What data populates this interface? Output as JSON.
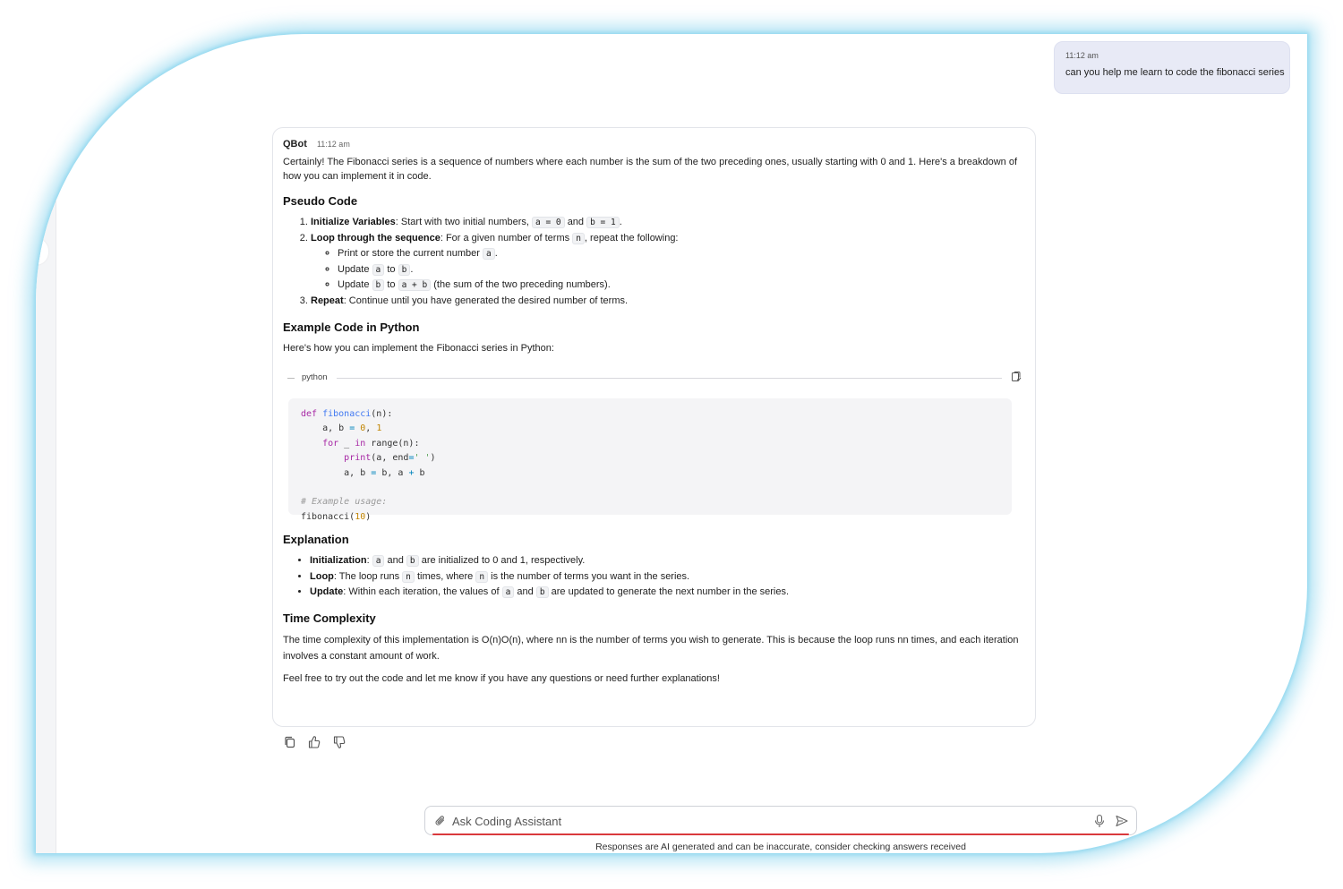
{
  "user_message": {
    "time": "11:12 am",
    "text": "can you help me learn to code the fibonacci series"
  },
  "bot_message": {
    "name": "QBot",
    "time": "11:12 am",
    "intro": "Certainly! The Fibonacci series is a sequence of numbers where each number is the sum of the two preceding ones, usually starting with 0 and 1. Here's a breakdown of how you can implement it in code.",
    "pseudo": {
      "heading": "Pseudo Code",
      "step1_title": "Initialize Variables",
      "step1_text": ": Start with two initial numbers,",
      "step1_code_a": "a = 0",
      "step1_and": "and",
      "step1_code_b": "b = 1",
      "step2_title": "Loop through the sequence",
      "step2_text": ": For a given number of terms",
      "step2_code_n": "n",
      "step2_text2": ", repeat the following:",
      "sub1_text": "Print or store the current number",
      "sub1_code": "a",
      "sub2_text": "Update",
      "sub2_code1": "a",
      "sub2_to": "to",
      "sub2_code2": "b",
      "sub3_text": "Update",
      "sub3_code1": "b",
      "sub3_to": "to",
      "sub3_code2": "a + b",
      "sub3_text2": "(the sum of the two preceding numbers).",
      "step3_title": "Repeat",
      "step3_text": ": Continue until you have generated the desired number of terms."
    },
    "example": {
      "heading": "Example Code in Python",
      "text": "Here's how you can implement the Fibonacci series in Python:",
      "language": "python"
    },
    "explanation": {
      "heading": "Explanation",
      "b1_title": "Initialization",
      "b1_code1": "a",
      "b1_and": "and",
      "b1_code2": "b",
      "b1_text": "are initialized to 0 and 1, respectively.",
      "b2_title": "Loop",
      "b2_text": ": The loop runs",
      "b2_code": "n",
      "b2_text2": "times, where",
      "b2_code2": "n",
      "b2_text3": "is the number of terms you want in the series.",
      "b3_title": "Update",
      "b3_text": ": Within each iteration, the values of",
      "b3_code1": "a",
      "b3_and": "and",
      "b3_code2": "b",
      "b3_text2": "are updated to generate the next number in the series."
    },
    "complexity": {
      "heading": "Time Complexity",
      "text": "The time complexity of this implementation is O(n)O(n), where nn is the number of terms you wish to generate. This is because the loop runs nn times, and each iteration involves a constant amount of work."
    },
    "outro": "Feel free to try out the code and let me know if you have any questions or need further explanations!"
  },
  "icons": {
    "copy_code": "copy-code-icon",
    "copy": "copy-icon",
    "thumbs_up": "thumbs-up-icon",
    "thumbs_down": "thumbs-down-icon",
    "attach": "paperclip-icon",
    "mic": "microphone-icon",
    "send": "send-icon"
  },
  "input": {
    "placeholder": "Ask Coding Assistant",
    "value": ""
  },
  "disclaimer": "Responses are AI generated and can be inaccurate, consider checking answers received",
  "colors": {
    "frame_glow": "#78cdeb",
    "user_bubble": "#e8eaf6",
    "input_underline": "#d9393c"
  }
}
